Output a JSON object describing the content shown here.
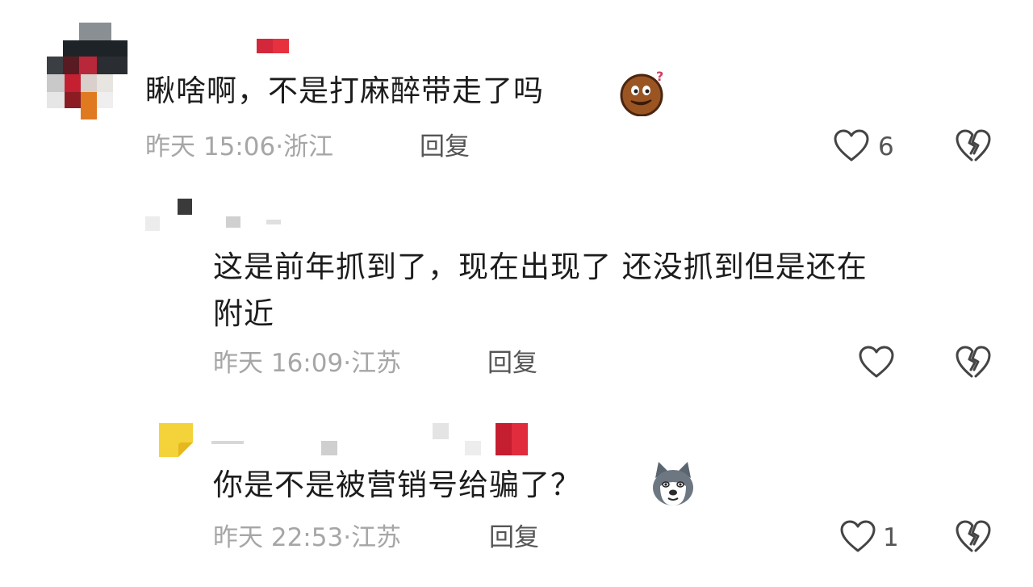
{
  "comments": [
    {
      "text": "瞅啥啊，不是打麻醉带走了吗",
      "time": "昨天 15:06",
      "sep": "·",
      "location": "浙江",
      "reply_label": "回复",
      "likes": "6",
      "emoji": "confused-face-emoji"
    },
    {
      "text_line1": "这是前年抓到了，现在出现了  还没抓到但是还在",
      "text_line2": "附近",
      "time": "昨天 16:09",
      "sep": "·",
      "location": "江苏",
      "reply_label": "回复",
      "likes": ""
    },
    {
      "text": "你是不是被营销号给骗了？",
      "time": "昨天 22:53",
      "sep": "·",
      "location": "江苏",
      "reply_label": "回复",
      "likes": "1",
      "emoji": "husky-dog-emoji"
    }
  ],
  "icons": {
    "like": "heart-outline-icon",
    "dislike": "broken-heart-icon"
  },
  "colors": {
    "text": "#1c1c1c",
    "meta": "#a6a6a6",
    "action": "#555555",
    "icon": "#444444"
  }
}
